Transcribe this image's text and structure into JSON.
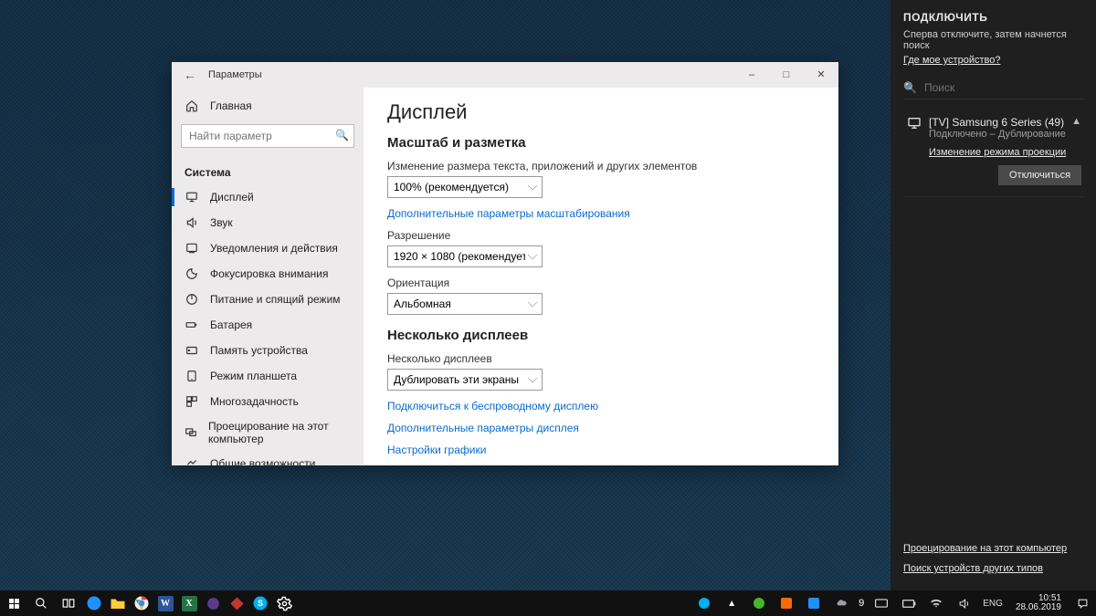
{
  "window": {
    "title": "Параметры",
    "home_label": "Главная",
    "search_placeholder": "Найти параметр",
    "category": "Система",
    "nav": [
      "Дисплей",
      "Звук",
      "Уведомления и действия",
      "Фокусировка внимания",
      "Питание и спящий режим",
      "Батарея",
      "Память устройства",
      "Режим планшета",
      "Многозадачность",
      "Проецирование на этот компьютер",
      "Общие возможности"
    ]
  },
  "content": {
    "heading": "Дисплей",
    "section1": "Масштаб и разметка",
    "scale_label": "Изменение размера текста, приложений и других элементов",
    "scale_value": "100% (рекомендуется)",
    "link_scale_adv": "Дополнительные параметры масштабирования",
    "res_label": "Разрешение",
    "res_value": "1920 × 1080 (рекомендуется)",
    "orient_label": "Ориентация",
    "orient_value": "Альбомная",
    "section2": "Несколько дисплеев",
    "multi_label": "Несколько дисплеев",
    "multi_value": "Дублировать эти экраны",
    "link_wireless": "Подключиться к беспроводному дисплею",
    "link_adv_display": "Дополнительные параметры дисплея",
    "link_graphics": "Настройки графики"
  },
  "connect": {
    "title": "ПОДКЛЮЧИТЬ",
    "hint": "Сперва отключите, затем начнется поиск",
    "where": "Где мое устройство?",
    "search_placeholder": "Поиск",
    "device_name": "[TV] Samsung 6 Series (49)",
    "device_status": "Подключено – Дублирование",
    "projection_link": "Изменение режима проекции",
    "disconnect": "Отключиться",
    "footer_project": "Проецирование на этот компьютер",
    "footer_other": "Поиск устройств других типов"
  },
  "taskbar": {
    "lang": "ENG",
    "tray_num": "9",
    "time": "10:51",
    "date": "28.06.2019"
  }
}
